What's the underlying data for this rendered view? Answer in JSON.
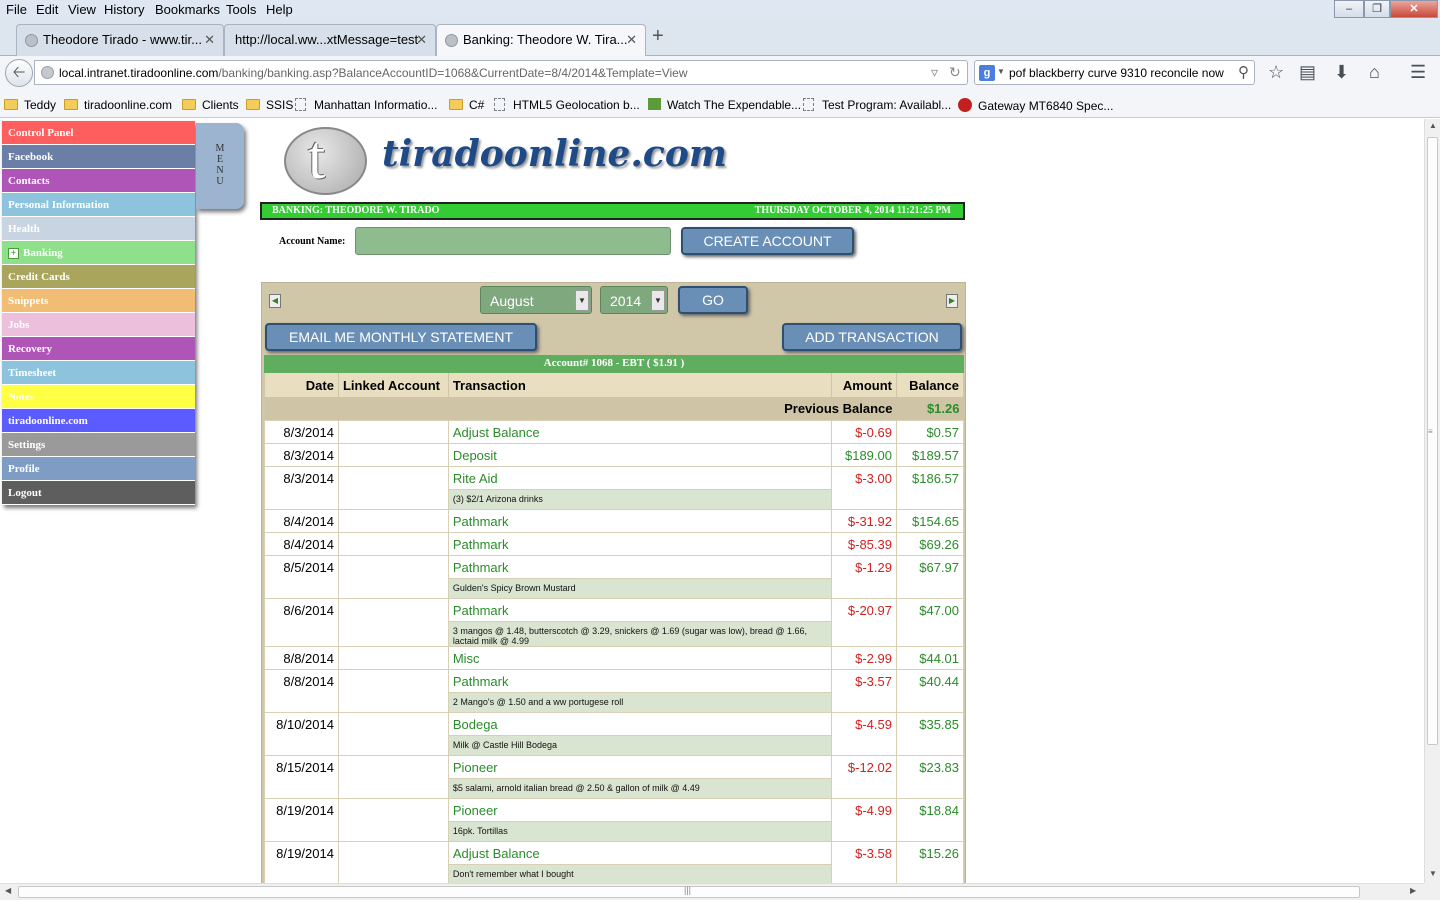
{
  "browser": {
    "menu": [
      "File",
      "Edit",
      "View",
      "History",
      "Bookmarks",
      "Tools",
      "Help"
    ],
    "tabs": [
      {
        "label": "Theodore Tirado - www.tir...",
        "active": false
      },
      {
        "label": "http://local.ww...xtMessage=test",
        "active": false
      },
      {
        "label": "Banking: Theodore W. Tira...",
        "active": true
      }
    ],
    "url_host": "local.intranet.tiradoonline.com",
    "url_path": "/banking/banking.asp?BalanceAccountID=1068&CurrentDate=8/4/2014&Template=View",
    "search_query": "pof blackberry curve 9310 reconcile now",
    "bookmarks": [
      {
        "label": "Teddy",
        "icon": "folder-icon"
      },
      {
        "label": "tiradoonline.com",
        "icon": "folder-icon"
      },
      {
        "label": "Clients",
        "icon": "folder-icon"
      },
      {
        "label": "SSIS",
        "icon": "folder-icon"
      },
      {
        "label": "Manhattan Informatio...",
        "icon": "page-icon"
      },
      {
        "label": "C#",
        "icon": "folder-icon"
      },
      {
        "label": "HTML5 Geolocation b...",
        "icon": "page-icon"
      },
      {
        "label": "Watch The Expendable...",
        "icon": "video-icon"
      },
      {
        "label": "Test Program: Availabl...",
        "icon": "page-icon"
      },
      {
        "label": "Gateway MT6840 Spec...",
        "icon": "gateway-icon"
      }
    ]
  },
  "sidebar": {
    "menu_tab": [
      "M",
      "E",
      "N",
      "U"
    ],
    "items": [
      {
        "label": "Control Panel",
        "color": "#ff5e5e"
      },
      {
        "label": "Facebook",
        "color": "#6a7ea6"
      },
      {
        "label": "Contacts",
        "color": "#b055b8"
      },
      {
        "label": "Personal Information",
        "color": "#8ec3de"
      },
      {
        "label": "Health",
        "color": "#c9d4e2"
      },
      {
        "label": "Banking",
        "color": "#8fe08a"
      },
      {
        "label": "Credit Cards",
        "color": "#aaa55c"
      },
      {
        "label": "Snippets",
        "color": "#f1bd74"
      },
      {
        "label": "Jobs",
        "color": "#ecbfdc"
      },
      {
        "label": "Recovery",
        "color": "#b055b8"
      },
      {
        "label": "Timesheet",
        "color": "#8ec3de"
      },
      {
        "label": "Notes",
        "color": "#ffff44"
      },
      {
        "label": "tiradoonline.com",
        "color": "#5b5bff"
      },
      {
        "label": "Settings",
        "color": "#9a9a9a"
      },
      {
        "label": "Profile",
        "color": "#7e9cc4"
      },
      {
        "label": "Logout",
        "color": "#5e5e5e"
      }
    ]
  },
  "logo": {
    "letter": "t",
    "text": "tiradoonline.com"
  },
  "header": {
    "left": "BANKING: THEODORE W. TIRADO",
    "right": "THURSDAY OCTOBER 4, 2014 11:21:25 PM"
  },
  "account_form": {
    "label": "Account Name:",
    "value": "",
    "button": "CREATE ACCOUNT"
  },
  "controls": {
    "month": "August",
    "year": "2014",
    "go": "GO",
    "email_button": "EMAIL ME MONTHLY STATEMENT",
    "add_button": "ADD TRANSACTION"
  },
  "account_bar": "Account# 1068 - EBT ( $1.91 )",
  "table": {
    "headers": [
      "Date",
      "Linked Account",
      "Transaction",
      "Amount",
      "Balance"
    ],
    "previous_label": "Previous Balance",
    "previous_value": "$1.26",
    "rows": [
      {
        "date": "8/3/2014",
        "linked": "",
        "txn": "Adjust Balance",
        "amount": "$-0.69",
        "positive": false,
        "balance": "$0.57",
        "note": ""
      },
      {
        "date": "8/3/2014",
        "linked": "",
        "txn": "Deposit",
        "amount": "$189.00",
        "positive": true,
        "balance": "$189.57",
        "note": ""
      },
      {
        "date": "8/3/2014",
        "linked": "",
        "txn": "Rite Aid",
        "amount": "$-3.00",
        "positive": false,
        "balance": "$186.57",
        "note": "(3) $2/1 Arizona drinks"
      },
      {
        "date": "8/4/2014",
        "linked": "",
        "txn": "Pathmark",
        "amount": "$-31.92",
        "positive": false,
        "balance": "$154.65",
        "note": ""
      },
      {
        "date": "8/4/2014",
        "linked": "",
        "txn": "Pathmark",
        "amount": "$-85.39",
        "positive": false,
        "balance": "$69.26",
        "note": ""
      },
      {
        "date": "8/5/2014",
        "linked": "",
        "txn": "Pathmark",
        "amount": "$-1.29",
        "positive": false,
        "balance": "$67.97",
        "note": "Gulden's Spicy Brown Mustard"
      },
      {
        "date": "8/6/2014",
        "linked": "",
        "txn": "Pathmark",
        "amount": "$-20.97",
        "positive": false,
        "balance": "$47.00",
        "note": "3 mangos @ 1.48, butterscotch @ 3.29, snickers @ 1.69 (sugar was low), bread @ 1.66, lactaid milk @ 4.99"
      },
      {
        "date": "8/8/2014",
        "linked": "",
        "txn": "Misc",
        "amount": "$-2.99",
        "positive": false,
        "balance": "$44.01",
        "note": ""
      },
      {
        "date": "8/8/2014",
        "linked": "",
        "txn": "Pathmark",
        "amount": "$-3.57",
        "positive": false,
        "balance": "$40.44",
        "note": "2 Mango's @ 1.50 and a ww portugese roll"
      },
      {
        "date": "8/10/2014",
        "linked": "",
        "txn": "Bodega",
        "amount": "$-4.59",
        "positive": false,
        "balance": "$35.85",
        "note": "Milk @ Castle Hill Bodega"
      },
      {
        "date": "8/15/2014",
        "linked": "",
        "txn": "Pioneer",
        "amount": "$-12.02",
        "positive": false,
        "balance": "$23.83",
        "note": "$5 salami, arnold italian bread @ 2.50 & gallon of milk @ 4.49"
      },
      {
        "date": "8/19/2014",
        "linked": "",
        "txn": "Pioneer",
        "amount": "$-4.99",
        "positive": false,
        "balance": "$18.84",
        "note": "16pk. Tortillas"
      },
      {
        "date": "8/19/2014",
        "linked": "",
        "txn": "Adjust Balance",
        "amount": "$-3.58",
        "positive": false,
        "balance": "$15.26",
        "note": "Don't remember what I bought"
      }
    ]
  }
}
